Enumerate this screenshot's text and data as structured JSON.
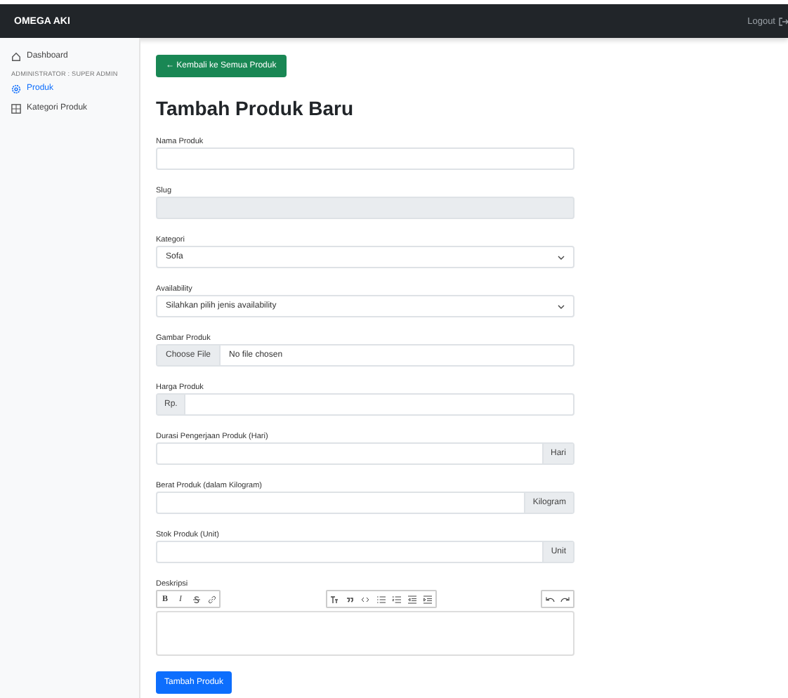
{
  "navbar": {
    "brand": "OMEGA AKI",
    "logout": "Logout"
  },
  "sidebar": {
    "items": [
      {
        "kind": "link",
        "label": "Dashboard",
        "selected": false
      },
      {
        "kind": "heading",
        "label": "ADMINISTRATOR : SUPER ADMIN"
      },
      {
        "kind": "link",
        "label": "Produk",
        "selected": true
      },
      {
        "kind": "link",
        "label": "Kategori Produk",
        "selected": false
      }
    ]
  },
  "back_button": "← Kembali ke Semua Produk",
  "title": "Tambah Produk Baru",
  "fields": [
    {
      "kind": "text",
      "label": "Nama Produk"
    },
    {
      "kind": "readonly",
      "label": "Slug"
    },
    {
      "kind": "select",
      "label": "Kategori",
      "value": "Sofa"
    },
    {
      "kind": "select",
      "label": "Availability",
      "value": "Silahkan pilih jenis availability"
    },
    {
      "kind": "file",
      "label": "Gambar Produk",
      "button": "Choose File",
      "value": "No file chosen"
    },
    {
      "kind": "prefix",
      "label": "Harga Produk",
      "addon": "Rp."
    },
    {
      "kind": "suffix",
      "label": "Durasi Pengerjaan Produk (Hari)",
      "addon": "Hari"
    },
    {
      "kind": "suffix",
      "label": "Berat Produk (dalam Kilogram)",
      "addon": "Kilogram"
    },
    {
      "kind": "suffix",
      "label": "Stok Produk (Unit)",
      "addon": "Unit"
    },
    {
      "kind": "editor",
      "label": "Deskripsi"
    }
  ],
  "toolbar": [
    [
      {
        "kind": "bold",
        "label": "B"
      },
      {
        "kind": "italic",
        "label": "I"
      },
      {
        "kind": "strike"
      },
      {
        "kind": "link"
      }
    ],
    [
      {
        "kind": "heading"
      },
      {
        "kind": "quote"
      },
      {
        "kind": "code"
      },
      {
        "kind": "bullets"
      },
      {
        "kind": "numbers"
      },
      {
        "kind": "outdent"
      },
      {
        "kind": "indent"
      }
    ],
    [
      {
        "kind": "undo"
      },
      {
        "kind": "redo"
      }
    ]
  ],
  "submit_button": "Tambah Produk"
}
